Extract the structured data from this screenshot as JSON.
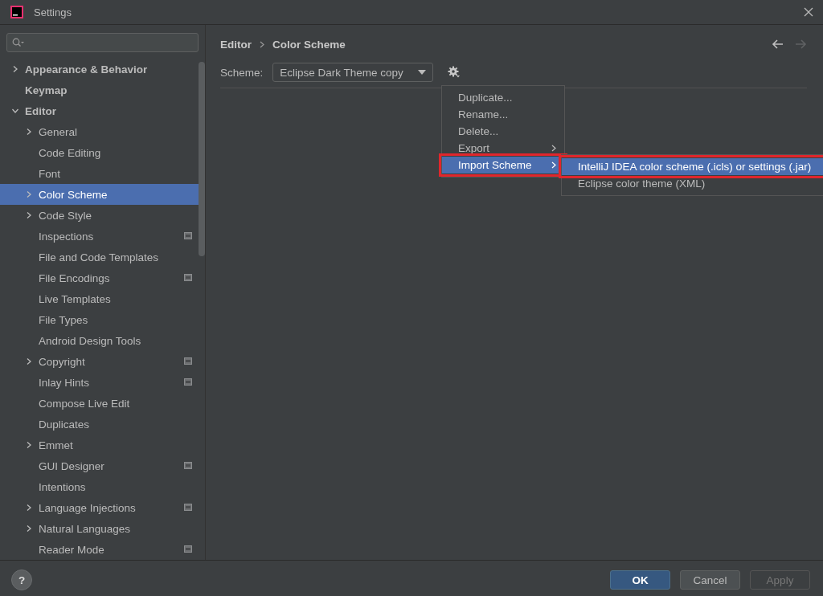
{
  "window": {
    "title": "Settings"
  },
  "sidebar": {
    "items": [
      {
        "label": "Appearance & Behavior",
        "kind": "group",
        "expanded": false,
        "selected": false,
        "project_level": false
      },
      {
        "label": "Keymap",
        "kind": "page",
        "selected": false,
        "project_level": false
      },
      {
        "label": "Editor",
        "kind": "group",
        "expanded": true,
        "selected": false,
        "project_level": false,
        "children": [
          {
            "label": "General",
            "kind": "group",
            "expanded": false,
            "selected": false,
            "project_level": false
          },
          {
            "label": "Code Editing",
            "kind": "page",
            "selected": false,
            "project_level": false
          },
          {
            "label": "Font",
            "kind": "page",
            "selected": false,
            "project_level": false
          },
          {
            "label": "Color Scheme",
            "kind": "group",
            "expanded": false,
            "selected": true,
            "project_level": false
          },
          {
            "label": "Code Style",
            "kind": "group",
            "expanded": false,
            "selected": false,
            "project_level": false
          },
          {
            "label": "Inspections",
            "kind": "page",
            "selected": false,
            "project_level": true
          },
          {
            "label": "File and Code Templates",
            "kind": "page",
            "selected": false,
            "project_level": false
          },
          {
            "label": "File Encodings",
            "kind": "page",
            "selected": false,
            "project_level": true
          },
          {
            "label": "Live Templates",
            "kind": "page",
            "selected": false,
            "project_level": false
          },
          {
            "label": "File Types",
            "kind": "page",
            "selected": false,
            "project_level": false
          },
          {
            "label": "Android Design Tools",
            "kind": "page",
            "selected": false,
            "project_level": false
          },
          {
            "label": "Copyright",
            "kind": "group",
            "expanded": false,
            "selected": false,
            "project_level": true
          },
          {
            "label": "Inlay Hints",
            "kind": "page",
            "selected": false,
            "project_level": true
          },
          {
            "label": "Compose Live Edit",
            "kind": "page",
            "selected": false,
            "project_level": false
          },
          {
            "label": "Duplicates",
            "kind": "page",
            "selected": false,
            "project_level": false
          },
          {
            "label": "Emmet",
            "kind": "group",
            "expanded": false,
            "selected": false,
            "project_level": false
          },
          {
            "label": "GUI Designer",
            "kind": "page",
            "selected": false,
            "project_level": true
          },
          {
            "label": "Intentions",
            "kind": "page",
            "selected": false,
            "project_level": false
          },
          {
            "label": "Language Injections",
            "kind": "group",
            "expanded": false,
            "selected": false,
            "project_level": true
          },
          {
            "label": "Natural Languages",
            "kind": "group",
            "expanded": false,
            "selected": false,
            "project_level": false
          },
          {
            "label": "Reader Mode",
            "kind": "page",
            "selected": false,
            "project_level": true
          }
        ]
      }
    ]
  },
  "breadcrumb": [
    "Editor",
    "Color Scheme"
  ],
  "nav": {
    "back": {
      "disabled": false
    },
    "forward": {
      "disabled": true
    }
  },
  "scheme": {
    "label": "Scheme:",
    "value": "Eclipse Dark Theme copy"
  },
  "menu": {
    "items": [
      {
        "label": "Duplicate...",
        "submenu": false,
        "selected": false,
        "annotated": false
      },
      {
        "label": "Rename...",
        "submenu": false,
        "selected": false,
        "annotated": false
      },
      {
        "label": "Delete...",
        "submenu": false,
        "selected": false,
        "annotated": false
      },
      {
        "label": "Export",
        "submenu": true,
        "selected": false,
        "annotated": false
      },
      {
        "label": "Import Scheme",
        "submenu": true,
        "selected": true,
        "annotated": true
      }
    ]
  },
  "submenu": {
    "items": [
      {
        "label": "IntelliJ IDEA color scheme (.icls) or settings (.jar)",
        "selected": true,
        "annotated": true
      },
      {
        "label": "Eclipse color theme (XML)",
        "selected": false,
        "annotated": false
      }
    ]
  },
  "help": {
    "label": "?"
  },
  "buttons": [
    {
      "label": "OK",
      "kind": "primary",
      "disabled": false
    },
    {
      "label": "Cancel",
      "kind": "normal",
      "disabled": false
    },
    {
      "label": "Apply",
      "kind": "normal",
      "disabled": true
    }
  ]
}
